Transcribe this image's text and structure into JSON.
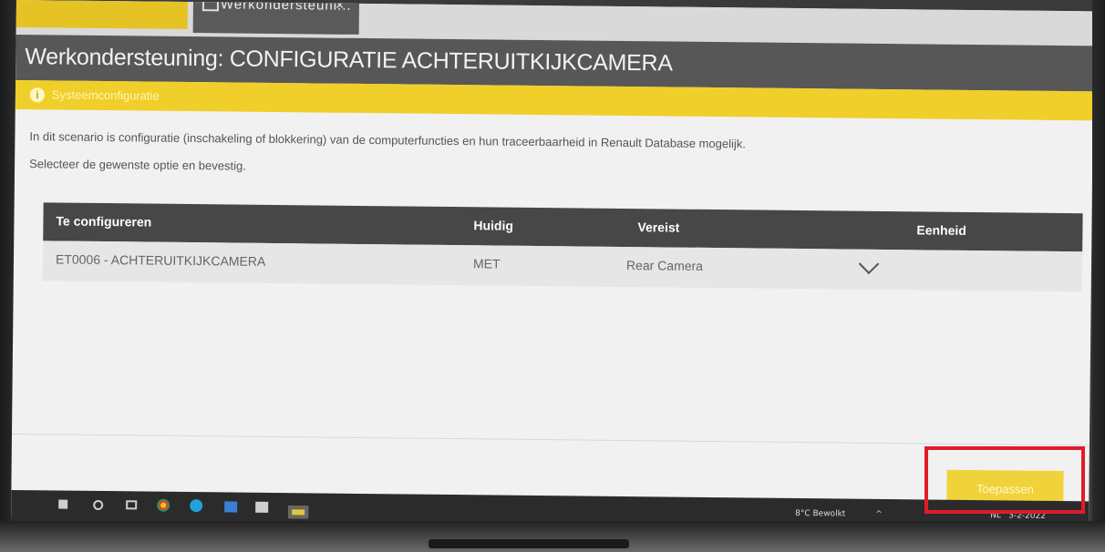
{
  "tabs": {
    "second_label": "Werkondersteuni...",
    "close_glyph": "×"
  },
  "title": "Werkondersteuning: CONFIGURATIE ACHTERUITKIJKCAMERA",
  "banner": {
    "text": "Systeemconfiguratie",
    "icon": "info-icon",
    "color": "#f0cf2a"
  },
  "description": {
    "line1": "In dit scenario is configuratie (inschakeling of blokkering) van de computerfuncties en hun traceerbaarheid in Renault Database mogelijk.",
    "line2": "Selecteer de gewenste optie en bevestig."
  },
  "table": {
    "headers": [
      "Te configureren",
      "Huidig",
      "Vereist",
      "Eenheid"
    ],
    "rows": [
      {
        "item": "ET0006 - ACHTERUITKIJKCAMERA",
        "current": "MET",
        "required": "Rear Camera",
        "unit": ""
      }
    ]
  },
  "apply_label": "Toepassen",
  "taskbar": {
    "weather": "8°C Bewolkt",
    "date": "3-2-2022",
    "lang": "NL"
  },
  "colors": {
    "accent_yellow": "#f0cf2a",
    "header_gray": "#575757",
    "highlight_red": "#e21b2b"
  }
}
